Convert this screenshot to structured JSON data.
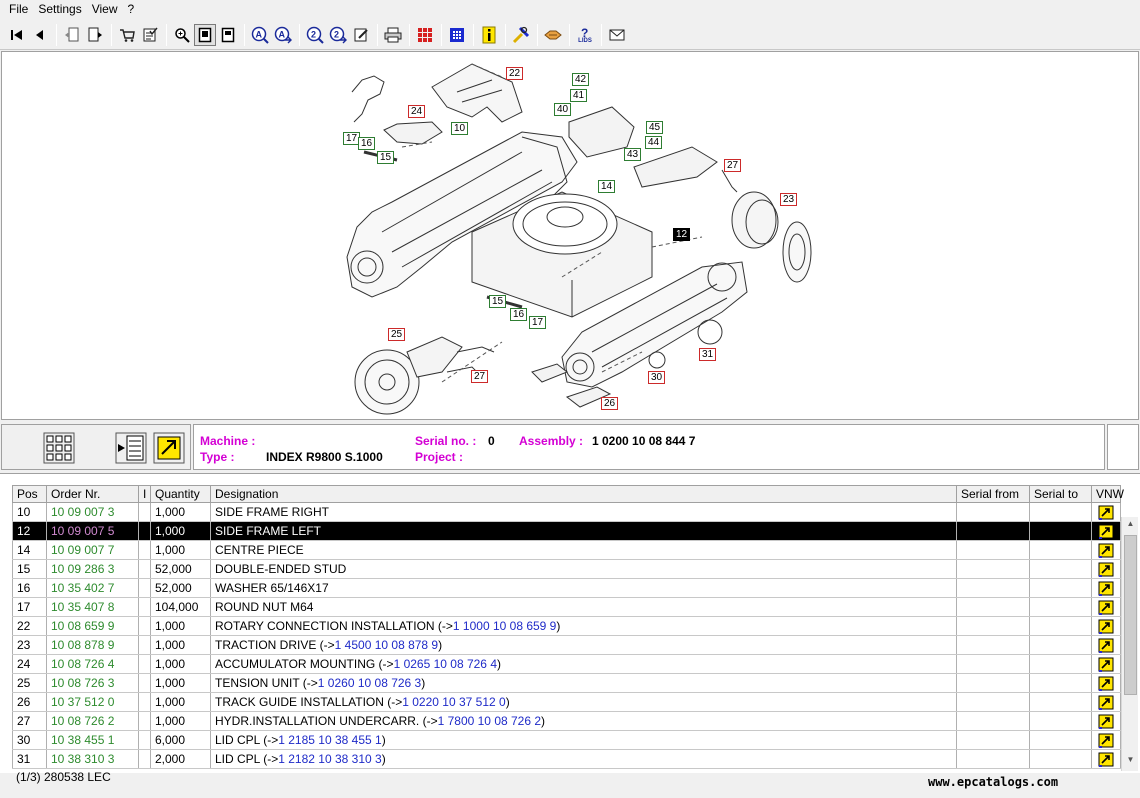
{
  "menu": [
    "File",
    "Settings",
    "View",
    "?"
  ],
  "toolbar": {
    "buttons": [
      "first-icon",
      "prev-icon",
      "doc-back-icon",
      "doc-forward-icon",
      "cart-icon",
      "checklist-icon",
      "zoom-in-icon",
      "page-icon",
      "page-fold-icon",
      "search-a-icon",
      "search-a-next-icon",
      "search-2-icon",
      "search-2-next-icon",
      "edit-icon",
      "print-icon",
      "grid-red-icon",
      "grid-blue-icon",
      "info-icon",
      "tools-icon",
      "hands-icon",
      "help-lid-icon",
      "mail-icon"
    ],
    "help_label": "LIDS"
  },
  "callouts": [
    {
      "id": "22",
      "style": "red"
    },
    {
      "id": "42",
      "style": "green"
    },
    {
      "id": "41",
      "style": "green"
    },
    {
      "id": "40",
      "style": "green"
    },
    {
      "id": "24",
      "style": "red"
    },
    {
      "id": "10",
      "style": "green"
    },
    {
      "id": "45",
      "style": "green"
    },
    {
      "id": "44",
      "style": "green"
    },
    {
      "id": "17",
      "style": "green"
    },
    {
      "id": "16",
      "style": "green"
    },
    {
      "id": "15",
      "style": "green"
    },
    {
      "id": "43",
      "style": "green"
    },
    {
      "id": "27",
      "style": "red"
    },
    {
      "id": "14",
      "style": "green"
    },
    {
      "id": "23",
      "style": "red"
    },
    {
      "id": "12",
      "style": "black"
    },
    {
      "id": "15",
      "style": "green"
    },
    {
      "id": "16",
      "style": "green"
    },
    {
      "id": "17",
      "style": "green"
    },
    {
      "id": "25",
      "style": "red"
    },
    {
      "id": "31",
      "style": "red"
    },
    {
      "id": "27",
      "style": "red"
    },
    {
      "id": "30",
      "style": "red"
    },
    {
      "id": "26",
      "style": "red"
    }
  ],
  "info": {
    "machine_label": "Machine :",
    "machine_value": "",
    "type_label": "Type :",
    "type_value": "INDEX R9800 S.1000",
    "serial_label": "Serial no. :",
    "serial_value": "0",
    "project_label": "Project :",
    "project_value": "",
    "assembly_label": "Assembly :",
    "assembly_value": "1 0200 10 08 844 7"
  },
  "columns": [
    "Pos",
    "Order Nr.",
    "I",
    "Quantity",
    "Designation",
    "Serial from",
    "Serial to",
    "VNW"
  ],
  "rows": [
    {
      "pos": "10",
      "order": "10 09 007 3",
      "qty": "1,000",
      "desig": "SIDE FRAME RIGHT",
      "ref": ""
    },
    {
      "pos": "12",
      "order": "10 09 007 5",
      "qty": "1,000",
      "desig": "SIDE FRAME LEFT",
      "ref": "",
      "selected": true
    },
    {
      "pos": "14",
      "order": "10 09 007 7",
      "qty": "1,000",
      "desig": "CENTRE PIECE",
      "ref": ""
    },
    {
      "pos": "15",
      "order": "10 09 286 3",
      "qty": "52,000",
      "desig": "DOUBLE-ENDED STUD",
      "ref": ""
    },
    {
      "pos": "16",
      "order": "10 35 402 7",
      "qty": "52,000",
      "desig": "WASHER 65/146X17",
      "ref": ""
    },
    {
      "pos": "17",
      "order": "10 35 407 8",
      "qty": "104,000",
      "desig": "ROUND NUT M64",
      "ref": ""
    },
    {
      "pos": "22",
      "order": "10 08 659 9",
      "qty": "1,000",
      "desig": "ROTARY CONNECTION INSTALLATION (->",
      "ref": "1 1000 10 08 659 9"
    },
    {
      "pos": "23",
      "order": "10 08 878 9",
      "qty": "1,000",
      "desig": "TRACTION DRIVE (->",
      "ref": "1 4500 10 08 878 9"
    },
    {
      "pos": "24",
      "order": "10 08 726 4",
      "qty": "1,000",
      "desig": "ACCUMULATOR MOUNTING (->",
      "ref": "1 0265 10 08 726 4"
    },
    {
      "pos": "25",
      "order": "10 08 726 3",
      "qty": "1,000",
      "desig": "TENSION UNIT (->",
      "ref": "1 0260 10 08 726 3"
    },
    {
      "pos": "26",
      "order": "10 37 512 0",
      "qty": "1,000",
      "desig": "TRACK GUIDE INSTALLATION (->",
      "ref": "1 0220 10 37 512 0"
    },
    {
      "pos": "27",
      "order": "10 08 726 2",
      "qty": "1,000",
      "desig": "HYDR.INSTALLATION UNDERCARR. (->",
      "ref": "1 7800 10 08 726 2"
    },
    {
      "pos": "30",
      "order": "10 38 455 1",
      "qty": "6,000",
      "desig": "LID CPL (->",
      "ref": "1 2185 10 38 455 1"
    },
    {
      "pos": "31",
      "order": "10 38 310 3",
      "qty": "2,000",
      "desig": "LID CPL (->",
      "ref": "1 2182 10 38 310 3"
    }
  ],
  "status": "(1/3) 280538 LEC",
  "watermark": "www.epcatalogs.com",
  "colors": {
    "order_green": "#2e8b2e",
    "label_magenta": "#d400d4",
    "ref_blue": "#1f2bc8",
    "callout_red": "#cc2a2a",
    "callout_green": "#2e7d32"
  }
}
